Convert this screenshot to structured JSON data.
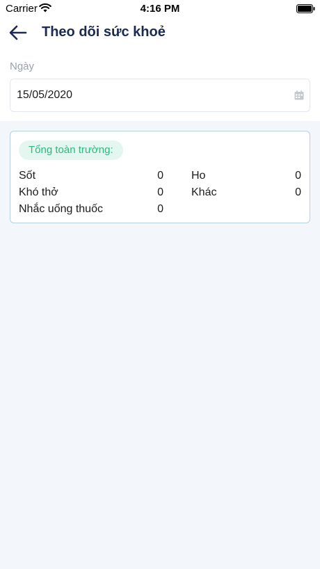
{
  "status_bar": {
    "carrier": "Carrier",
    "time": "4:16 PM"
  },
  "header": {
    "title": "Theo dõi sức khoẻ",
    "back_icon": "arrow-left-icon"
  },
  "date_field": {
    "label": "Ngày",
    "value": "15/05/2020",
    "icon": "calendar-icon"
  },
  "summary": {
    "title": "Tổng toàn trường:",
    "stats": [
      {
        "label": "Sốt",
        "value": "0"
      },
      {
        "label": "Ho",
        "value": "0"
      },
      {
        "label": "Khó thở",
        "value": "0"
      },
      {
        "label": "Khác",
        "value": "0"
      },
      {
        "label": "Nhắc uống thuốc",
        "value": "0"
      }
    ]
  },
  "colors": {
    "title": "#1a2a52",
    "badge_bg": "#e3f6ef",
    "badge_text": "#2eb87e",
    "card_border": "#b7d0e0",
    "page_bg": "#f3f7fb"
  }
}
